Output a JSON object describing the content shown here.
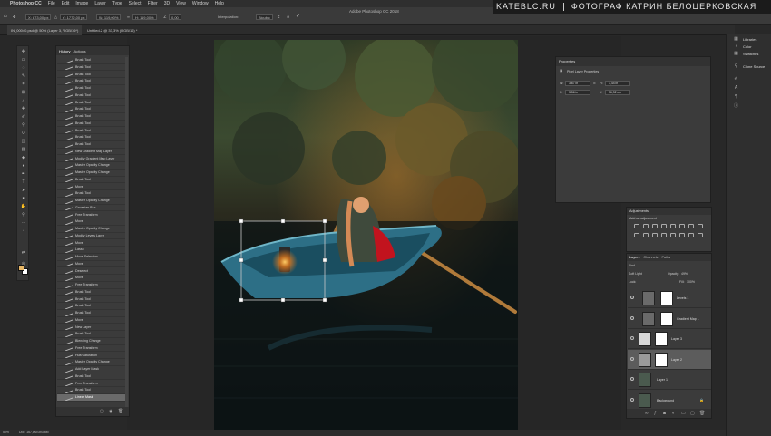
{
  "menubar": {
    "app_name": "Photoshop CC",
    "items": [
      "File",
      "Edit",
      "Image",
      "Layer",
      "Type",
      "Select",
      "Filter",
      "3D",
      "View",
      "Window",
      "Help"
    ]
  },
  "window_title": "Adobe Photoshop CC 2018",
  "watermark": {
    "left": "KATEBLC.RU",
    "right": "ФОТОГРАФ КАТРИН БЕЛОЦЕРКОВСКАЯ"
  },
  "options_bar": {
    "x_value": "X: 873,00 px",
    "y_value": "Y: 1772,00 px",
    "w_value": "W: 119,00%",
    "h_value": "H: 119,00%",
    "angle_value": "0,00",
    "interpolation_label": "Interpolation:",
    "interpolation_value": "Bicubic"
  },
  "doc_tabs": [
    {
      "label": "IN_00040.psd @ 50% (Layer 3, RGB/16*)"
    },
    {
      "label": "Untitled-2 @ 33,3% (RGB/16) *"
    }
  ],
  "history": {
    "tabs": [
      "History",
      "Actions"
    ],
    "items": [
      "Brush Tool",
      "Brush Tool",
      "Brush Tool",
      "Brush Tool",
      "Brush Tool",
      "Brush Tool",
      "Brush Tool",
      "Brush Tool",
      "Brush Tool",
      "Brush Tool",
      "Brush Tool",
      "Brush Tool",
      "Brush Tool",
      "New Gradient Map Layer",
      "Modify Gradient Map Layer",
      "Master Opacity Change",
      "Master Opacity Change",
      "Brush Tool",
      "Move",
      "Brush Tool",
      "Master Opacity Change",
      "Gaussian Blur",
      "Free Transform",
      "Move",
      "Master Opacity Change",
      "Modify Levels Layer",
      "Move",
      "Lasso",
      "Move Selection",
      "Move",
      "Deselect",
      "Move",
      "Free Transform",
      "Brush Tool",
      "Brush Tool",
      "Brush Tool",
      "Brush Tool",
      "Move",
      "New Layer",
      "Brush Tool",
      "Blending Change",
      "Free Transform",
      "Hue/Saturation",
      "Master Opacity Change",
      "Add Layer Mask",
      "Brush Tool",
      "Free Transform",
      "Brush Tool",
      "Linear Mask"
    ],
    "selected_index": 48
  },
  "properties": {
    "title": "Properties",
    "subtitle": "Pixel Layer Properties",
    "w": "3,67 in",
    "h": "3,44 in",
    "x": "3,56 in",
    "y": "56,92 cm",
    "lbl_w": "W:",
    "lbl_h": "H:",
    "lbl_x": "X:",
    "lbl_y": "Y:",
    "link_icon": "link-icon"
  },
  "adjustments": {
    "title": "Adjustments",
    "subtitle": "Add an adjustment"
  },
  "layers_panel": {
    "tabs": [
      "Layers",
      "Channels",
      "Paths"
    ],
    "kind_label": "Kind",
    "blend_mode": "Soft Light",
    "opacity_label": "Opacity:",
    "opacity_value": "49%",
    "lock_label": "Lock:",
    "fill_label": "Fill:",
    "fill_value": "100%",
    "layers": [
      {
        "name": "Levels 1",
        "type": "adjustment"
      },
      {
        "name": "Gradient Map 1",
        "type": "adjustment"
      },
      {
        "name": "Layer 3",
        "type": "pixel-mask"
      },
      {
        "name": "Layer 2",
        "type": "pixel-mask"
      },
      {
        "name": "Layer 1",
        "type": "pixel"
      },
      {
        "name": "Background",
        "type": "pixel"
      }
    ],
    "selected_index": 3
  },
  "dock": {
    "entries": [
      "Libraries",
      "Color",
      "Swatches",
      "Clone Source"
    ]
  },
  "status_bar": {
    "zoom": "50%",
    "doc": "Doc: 167,8M/393,8M"
  },
  "colors": {
    "foreground": "#e8b766",
    "background": "#ffffff",
    "boat": "#2d6f86",
    "cloak_red": "#c2131e"
  }
}
